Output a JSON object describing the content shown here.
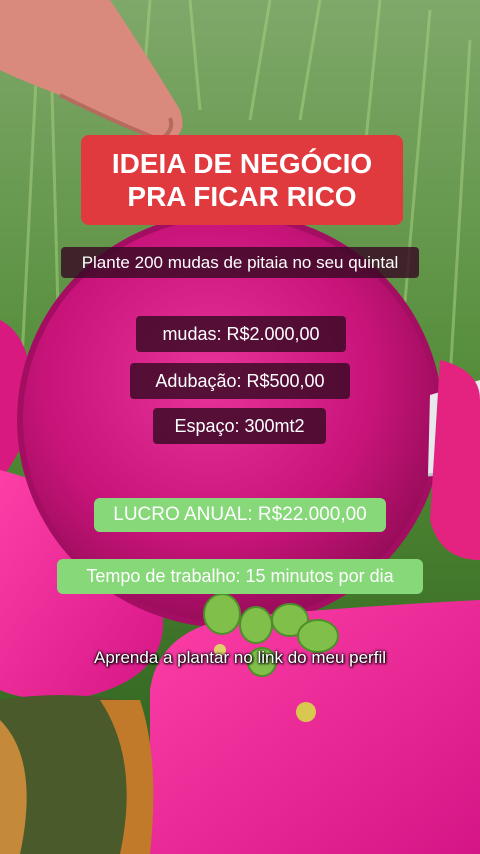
{
  "title": {
    "line1": "IDEIA DE NEGÓCIO",
    "line2": "PRA FICAR RICO"
  },
  "subtitle": "Plante 200 mudas de pitaia no seu quintal",
  "costs": {
    "mudas": "mudas: R$2.000,00",
    "adubacao": "Adubação: R$500,00",
    "espaco": "Espaço: 300mt2"
  },
  "profit": "LUCRO ANUAL: R$22.000,00",
  "work_time": "Tempo de trabalho: 15 minutos por dia",
  "caption": "Aprenda a plantar no link do meu perfil",
  "colors": {
    "title_bg": "#e03a3f",
    "dark_pill": "#3a0a24",
    "green_pill": "#86d879",
    "pitaya": "#e0198a"
  }
}
